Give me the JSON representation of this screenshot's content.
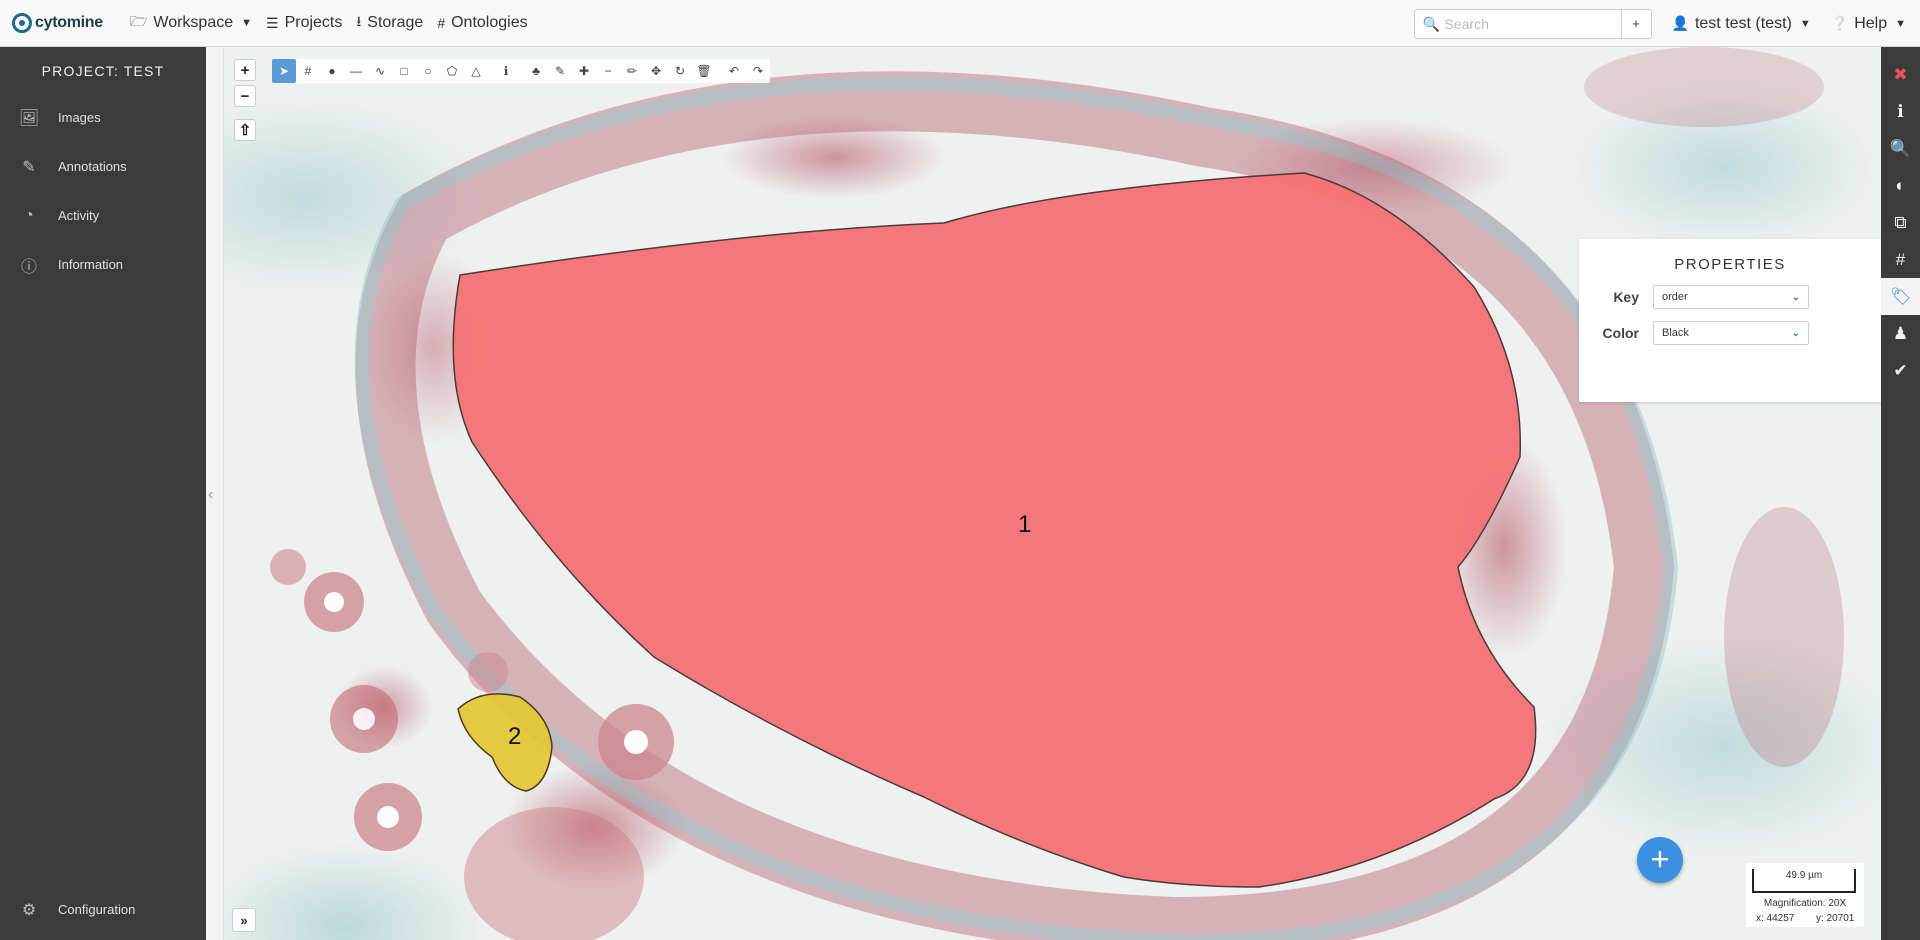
{
  "navbar": {
    "brand": "cytomine",
    "items": [
      {
        "label": "Workspace",
        "icon": "folder-open-icon",
        "has_caret": true
      },
      {
        "label": "Projects",
        "icon": "list-icon"
      },
      {
        "label": "Storage",
        "icon": "download-icon"
      },
      {
        "label": "Ontologies",
        "icon": "hashtag-icon"
      }
    ],
    "search_placeholder": "Search",
    "search_add": "+",
    "user": "test test (test)",
    "help": "Help"
  },
  "sidebar": {
    "project_title": "PROJECT: TEST",
    "items": [
      {
        "label": "Images",
        "icon": "images-icon"
      },
      {
        "label": "Annotations",
        "icon": "edit-icon"
      },
      {
        "label": "Activity",
        "icon": "dashboard-icon"
      },
      {
        "label": "Information",
        "icon": "info-circle-icon"
      }
    ],
    "config": {
      "label": "Configuration",
      "icon": "cogs-icon"
    }
  },
  "viewer": {
    "zoom_in": "+",
    "zoom_out": "−",
    "rotate_reset": "⇧",
    "expand": "»",
    "annotations": [
      {
        "label": "1",
        "color": "#f07070"
      },
      {
        "label": "2",
        "color": "#e3c637"
      }
    ],
    "scale_text": "49.9 µm",
    "magnification": "Magnification: 20X",
    "coord_x": "x: 44257",
    "coord_y": "y: 20701",
    "fab": "+"
  },
  "properties": {
    "title": "PROPERTIES",
    "key_label": "Key",
    "key_value": "order",
    "color_label": "Color",
    "color_value": "Black"
  }
}
